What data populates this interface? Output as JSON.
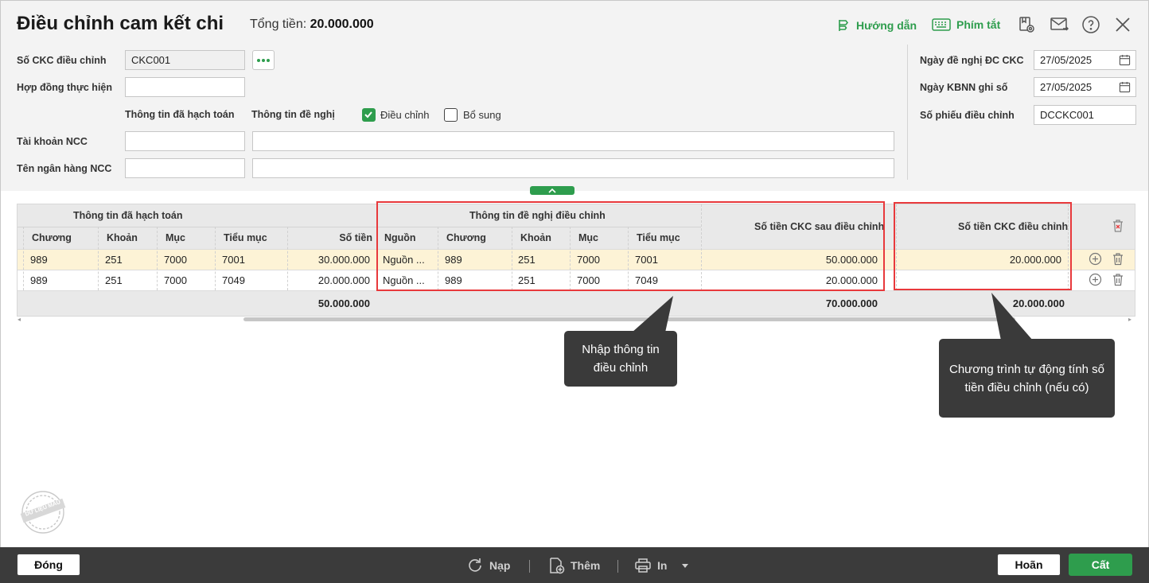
{
  "header": {
    "title": "Điều chỉnh cam kết chi",
    "total_label": "Tổng tiền:",
    "total_value": "20.000.000",
    "guide_label": "Hướng dẫn",
    "shortcut_label": "Phím tắt"
  },
  "form": {
    "ckc_label": "Số CKC điều chỉnh",
    "ckc_value": "CKC001",
    "contract_label": "Hợp đồng thực hiện",
    "contract_value": "",
    "accounted_info_label": "Thông tin đã hạch toán",
    "proposal_info_label": "Thông tin đề nghị",
    "adjust_label": "Điều chỉnh",
    "adjust_checked": true,
    "supplement_label": "Bổ sung",
    "supplement_checked": false,
    "account_label": "Tài khoản NCC",
    "bank_label": "Tên ngân hàng NCC",
    "propose_date_label": "Ngày đề nghị ĐC CKC",
    "propose_date_value": "27/05/2025",
    "kbnn_date_label": "Ngày KBNN ghi số",
    "kbnn_date_value": "27/05/2025",
    "voucher_label": "Số phiếu điều chỉnh",
    "voucher_value": "DCCKC001"
  },
  "grid": {
    "group_accounted": "Thông tin đã hạch toán",
    "group_proposal": "Thông tin đề nghị điều chỉnh",
    "col_after": "Số tiền CKC sau điều chỉnh",
    "col_adjust": "Số tiền CKC điều chỉnh",
    "columns_accounted": [
      "Chương",
      "Khoản",
      "Mục",
      "Tiểu mục",
      "Số tiền"
    ],
    "columns_proposal": [
      "Nguồn",
      "Chương",
      "Khoản",
      "Mục",
      "Tiểu mục"
    ],
    "rows": [
      {
        "chuong": "989",
        "khoan": "251",
        "muc": "7000",
        "tieumuc": "7001",
        "sotien": "30.000.000",
        "nguon": "Nguồn ...",
        "p_chuong": "989",
        "p_khoan": "251",
        "p_muc": "7000",
        "p_tieumuc": "7001",
        "after": "50.000.000",
        "adjust": "20.000.000"
      },
      {
        "chuong": "989",
        "khoan": "251",
        "muc": "7000",
        "tieumuc": "7049",
        "sotien": "20.000.000",
        "nguon": "Nguồn ...",
        "p_chuong": "989",
        "p_khoan": "251",
        "p_muc": "7000",
        "p_tieumuc": "7049",
        "after": "20.000.000",
        "adjust": ""
      }
    ],
    "totals": {
      "sotien": "50.000.000",
      "after": "70.000.000",
      "adjust": "20.000.000"
    }
  },
  "callouts": {
    "enter_info": "Nhập thông tin điều chỉnh",
    "auto_calc": "Chương trình tự động tính số tiền điều chỉnh (nếu có)"
  },
  "watermark": "DỮ LIỆU MẪU",
  "footer": {
    "close": "Đóng",
    "reload": "Nạp",
    "add": "Thêm",
    "print": "In",
    "cancel": "Hoãn",
    "save": "Cất"
  },
  "colors": {
    "accent": "#2e9d4d",
    "highlight": "#e8393c",
    "selected_row": "#fdf3d6"
  }
}
